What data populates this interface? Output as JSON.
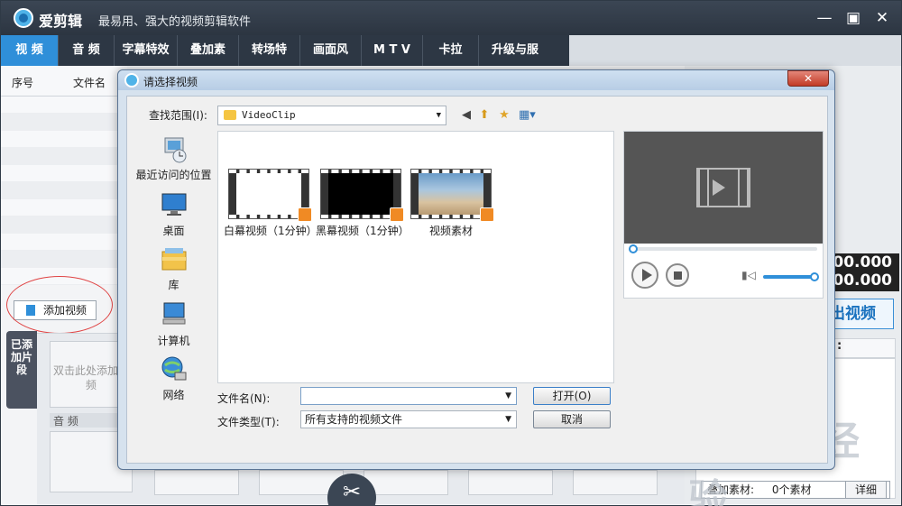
{
  "app": {
    "name": "爱剪辑",
    "slogan": "最易用、强大的视频剪辑软件",
    "window_buttons": [
      "minimize",
      "restore",
      "close"
    ]
  },
  "tabs": [
    {
      "label": "视 频",
      "active": true
    },
    {
      "label": "音 频"
    },
    {
      "label": "字幕特效"
    },
    {
      "label": "叠加素材"
    },
    {
      "label": "转场特效"
    },
    {
      "label": "画面风格"
    },
    {
      "label": "M T V"
    },
    {
      "label": "卡拉OK"
    },
    {
      "label": "升级与服务"
    }
  ],
  "file_list": {
    "col_index": "序号",
    "col_name": "文件名"
  },
  "add_video_button": "添加视频",
  "side_tab_label": "已添加片段",
  "clip_area": {
    "placeholder": "双击此处添加视频",
    "audio_label": "音 频"
  },
  "right_panel": {
    "time_1": "00.000",
    "time_2": "00.000",
    "export_label": "出视频",
    "colon": ":",
    "overlay_label": "叠加素材:",
    "overlay_count": "0个素材",
    "detail_button": "详细"
  },
  "dialog": {
    "title": "请选择视频",
    "look_in_label": "查找范围(I):",
    "look_in_value": "VideoClip",
    "places": [
      {
        "label": "最近访问的位置",
        "icon": "recent-places-icon"
      },
      {
        "label": "桌面",
        "icon": "desktop-icon"
      },
      {
        "label": "库",
        "icon": "library-icon"
      },
      {
        "label": "计算机",
        "icon": "computer-icon"
      },
      {
        "label": "网络",
        "icon": "network-icon"
      }
    ],
    "files": [
      {
        "label": "白幕视频（1分钟）",
        "thumb": "white"
      },
      {
        "label": "黑幕视频（1分钟）",
        "thumb": "black"
      },
      {
        "label": "视频素材",
        "thumb": "sky"
      }
    ],
    "filename_label": "文件名(N):",
    "filename_value": "",
    "filetype_label": "文件类型(T):",
    "filetype_value": "所有支持的视频文件",
    "open_button": "打开(O)",
    "cancel_button": "取消"
  },
  "watermark": "Baidu经验",
  "colors": {
    "accent": "#2f8fd9",
    "titlebar": "#2c3541",
    "highlight_ellipse": "#e04545"
  }
}
